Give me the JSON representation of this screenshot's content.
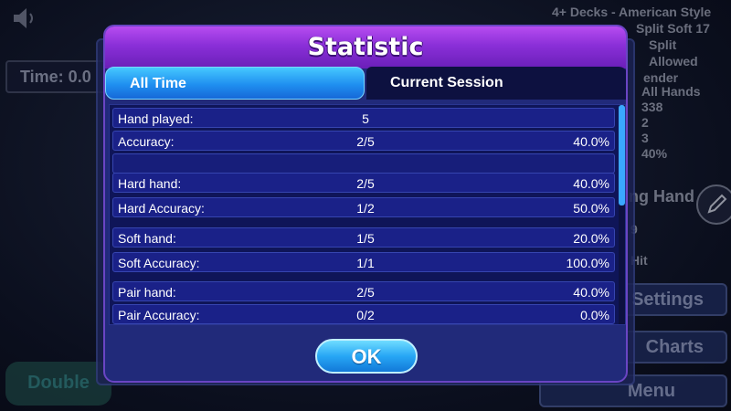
{
  "background": {
    "time_label": "Time: 0.0",
    "rules_lines": [
      "4+ Decks - American Style",
      "Split Soft 17",
      "Split Allowed",
      "ender"
    ],
    "stats_lines": [
      "All Hands",
      "338",
      "2",
      "3",
      "40%"
    ],
    "losing_label": "ng Hand",
    "losing_lines": [
      "9",
      "Hit"
    ],
    "settings_label": "Settings",
    "charts_label": "Charts",
    "menu_label": "Menu",
    "double_label": "Double"
  },
  "dialog": {
    "title": "Statistic",
    "tabs": [
      {
        "label": "All Time",
        "active": true
      },
      {
        "label": "Current Session",
        "active": false
      }
    ],
    "rows": [
      {
        "label": "Hand played:",
        "count": "5",
        "percent": ""
      },
      {
        "label": "Accuracy:",
        "count": "2/5",
        "percent": "40.0%"
      },
      {
        "label": "",
        "count": "",
        "percent": ""
      },
      {
        "label": "Hard hand:",
        "count": "2/5",
        "percent": "40.0%"
      },
      {
        "label": "Hard Accuracy:",
        "count": "1/2",
        "percent": "50.0%"
      },
      {
        "label": "Soft hand:",
        "count": "1/5",
        "percent": "20.0%"
      },
      {
        "label": "Soft Accuracy:",
        "count": "1/1",
        "percent": "100.0%"
      },
      {
        "label": "Pair hand:",
        "count": "2/5",
        "percent": "40.0%"
      },
      {
        "label": "Pair Accuracy:",
        "count": "0/2",
        "percent": "0.0%"
      }
    ],
    "ok_label": "OK"
  },
  "colors": {
    "title_purple": "#8a2fd8",
    "tab_active_blue": "#1f8ff0",
    "panel_navy": "#212a7a",
    "row_blue": "#1a2188",
    "scroll_thumb": "#3aa8ff"
  },
  "icons": {
    "speaker": "speaker-icon",
    "pencil": "pencil-icon"
  }
}
